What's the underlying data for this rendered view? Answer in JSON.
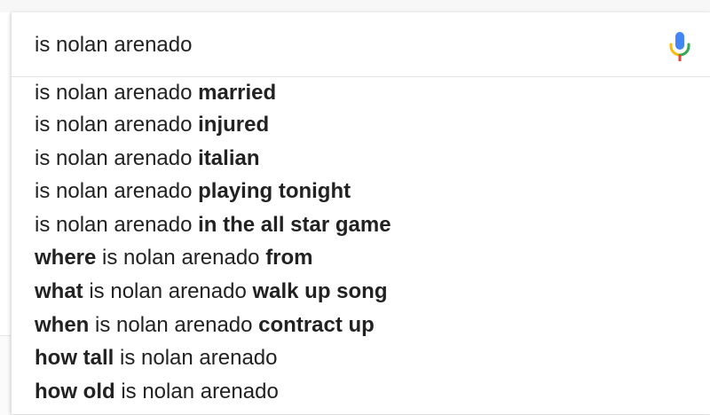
{
  "search": {
    "query": "is nolan arenado",
    "mic_icon": "microphone-icon",
    "colors": {
      "mic_blue": "#4285F4",
      "mic_red": "#EA4335",
      "mic_yellow": "#FBBC05",
      "mic_green": "#34A853"
    }
  },
  "suggestions": [
    {
      "before": "",
      "normal": "is nolan arenado",
      "after": "married"
    },
    {
      "before": "",
      "normal": "is nolan arenado",
      "after": "injured"
    },
    {
      "before": "",
      "normal": "is nolan arenado",
      "after": "italian"
    },
    {
      "before": "",
      "normal": "is nolan arenado",
      "after": "playing tonight"
    },
    {
      "before": "",
      "normal": "is nolan arenado",
      "after": "in the all star game"
    },
    {
      "before": "where",
      "normal": "is nolan arenado",
      "after": "from"
    },
    {
      "before": "what",
      "normal": "is nolan arenado",
      "after": "walk up song"
    },
    {
      "before": "when",
      "normal": "is nolan arenado",
      "after": "contract up"
    },
    {
      "before": "how tall",
      "normal": "is nolan arenado",
      "after": ""
    },
    {
      "before": "how old",
      "normal": "is nolan arenado",
      "after": ""
    }
  ]
}
